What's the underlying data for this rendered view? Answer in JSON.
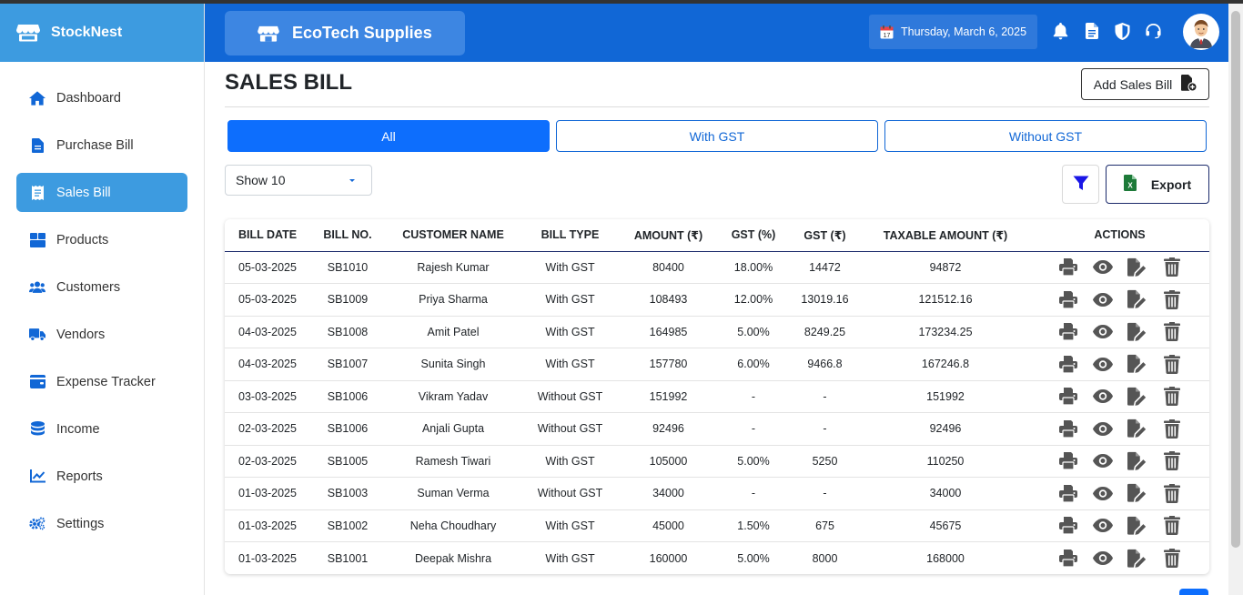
{
  "app": {
    "name": "StockNest"
  },
  "sidebar": {
    "items": [
      {
        "label": "Dashboard",
        "icon": "home-icon",
        "active": false
      },
      {
        "label": "Purchase Bill",
        "icon": "file-icon",
        "active": false
      },
      {
        "label": "Sales Bill",
        "icon": "receipt-icon",
        "active": true
      },
      {
        "label": "Products",
        "icon": "boxes-icon",
        "active": false
      },
      {
        "label": "Customers",
        "icon": "users-icon",
        "active": false
      },
      {
        "label": "Vendors",
        "icon": "truck-icon",
        "active": false
      },
      {
        "label": "Expense Tracker",
        "icon": "wallet-icon",
        "active": false
      },
      {
        "label": "Income",
        "icon": "coins-icon",
        "active": false
      },
      {
        "label": "Reports",
        "icon": "chart-line-icon",
        "active": false
      },
      {
        "label": "Settings",
        "icon": "gears-icon",
        "active": false
      }
    ]
  },
  "header": {
    "company": "EcoTech Supplies",
    "date": "Thursday, March 6, 2025",
    "icons": [
      "bell-icon",
      "document-icon",
      "shield-icon",
      "headset-icon"
    ],
    "avatar": "user-avatar"
  },
  "page": {
    "title": "SALES BILL",
    "add_label": "Add Sales Bill",
    "tabs": [
      {
        "label": "All",
        "active": true
      },
      {
        "label": "With GST",
        "active": false
      },
      {
        "label": "Without GST",
        "active": false
      }
    ],
    "show_value": "Show 10",
    "export_label": "Export"
  },
  "table": {
    "columns": [
      "BILL DATE",
      "BILL NO.",
      "CUSTOMER NAME",
      "BILL TYPE",
      "AMOUNT (₹)",
      "GST (%)",
      "GST (₹)",
      "TAXABLE AMOUNT (₹)",
      "ACTIONS"
    ],
    "rows": [
      [
        "05-03-2025",
        "SB1010",
        "Rajesh Kumar",
        "With GST",
        "80400",
        "18.00%",
        "14472",
        "94872"
      ],
      [
        "05-03-2025",
        "SB1009",
        "Priya Sharma",
        "With GST",
        "108493",
        "12.00%",
        "13019.16",
        "121512.16"
      ],
      [
        "04-03-2025",
        "SB1008",
        "Amit Patel",
        "With GST",
        "164985",
        "5.00%",
        "8249.25",
        "173234.25"
      ],
      [
        "04-03-2025",
        "SB1007",
        "Sunita Singh",
        "With GST",
        "157780",
        "6.00%",
        "9466.8",
        "167246.8"
      ],
      [
        "03-03-2025",
        "SB1006",
        "Vikram Yadav",
        "Without GST",
        "151992",
        "-",
        "-",
        "151992"
      ],
      [
        "02-03-2025",
        "SB1006",
        "Anjali Gupta",
        "Without GST",
        "92496",
        "-",
        "-",
        "92496"
      ],
      [
        "02-03-2025",
        "SB1005",
        "Ramesh Tiwari",
        "With GST",
        "105000",
        "5.00%",
        "5250",
        "110250"
      ],
      [
        "01-03-2025",
        "SB1003",
        "Suman Verma",
        "Without GST",
        "34000",
        "-",
        "-",
        "34000"
      ],
      [
        "01-03-2025",
        "SB1002",
        "Neha Choudhary",
        "With GST",
        "45000",
        "1.50%",
        "675",
        "45675"
      ],
      [
        "01-03-2025",
        "SB1001",
        "Deepak Mishra",
        "With GST",
        "160000",
        "5.00%",
        "8000",
        "168000"
      ]
    ],
    "action_icons": [
      "print-icon",
      "view-icon",
      "edit-icon",
      "delete-icon"
    ]
  },
  "colors": {
    "brand": "#3d9be0",
    "header": "#1167d6",
    "primary": "#0d6efd",
    "action": "#555555"
  }
}
